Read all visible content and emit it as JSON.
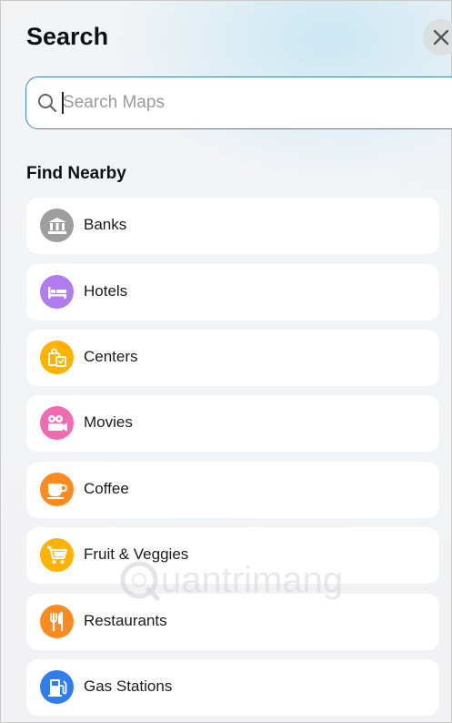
{
  "header": {
    "title": "Search"
  },
  "search": {
    "placeholder": "Search Maps"
  },
  "nearby": {
    "title": "Find Nearby",
    "items": [
      {
        "label": "Banks",
        "icon": "bank-icon",
        "color": "#9e9e9e"
      },
      {
        "label": "Hotels",
        "icon": "bed-icon",
        "color": "#b07cf0"
      },
      {
        "label": "Centers",
        "icon": "shopping-bag-icon",
        "color": "#ffb300"
      },
      {
        "label": "Movies",
        "icon": "movie-camera-icon",
        "color": "#f06bb0"
      },
      {
        "label": "Coffee",
        "icon": "coffee-cup-icon",
        "color": "#ff8a1f"
      },
      {
        "label": "Fruit & Veggies",
        "icon": "shopping-cart-icon",
        "color": "#ffb300"
      },
      {
        "label": "Restaurants",
        "icon": "fork-knife-icon",
        "color": "#ff8a1f"
      },
      {
        "label": "Gas Stations",
        "icon": "gas-pump-icon",
        "color": "#2f7df0"
      }
    ]
  },
  "watermark": {
    "text": "uantrimang"
  }
}
